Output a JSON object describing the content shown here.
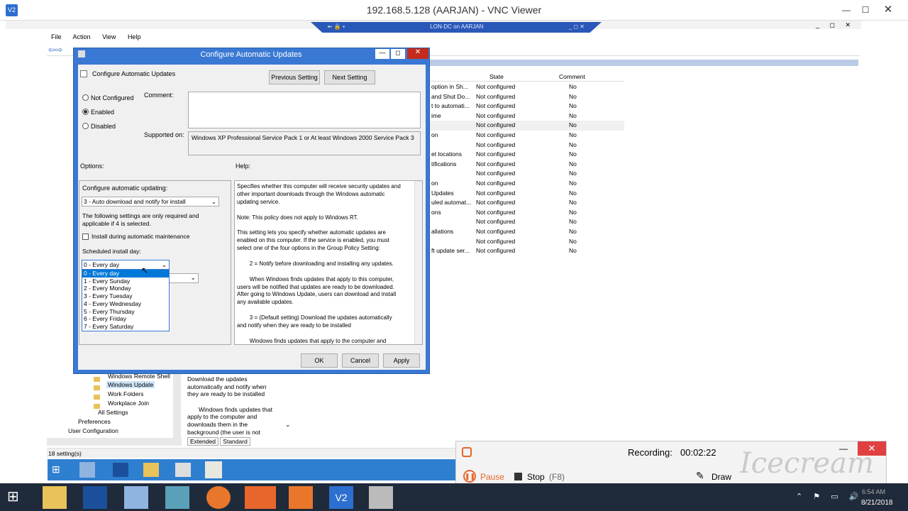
{
  "vnc": {
    "title": "192.168.5.128 (AARJAN) - VNC Viewer",
    "logo": "V2",
    "bar_text": "LON-DC on AARJAN"
  },
  "mmc": {
    "menu": [
      "File",
      "Action",
      "View",
      "Help"
    ],
    "columns": {
      "state": "State",
      "comment": "Comment"
    },
    "rows": [
      {
        "name": "option in Sh...",
        "state": "Not configured",
        "comment": "No"
      },
      {
        "name": "and Shut Do...",
        "state": "Not configured",
        "comment": "No"
      },
      {
        "name": "t to automati...",
        "state": "Not configured",
        "comment": "No"
      },
      {
        "name": "ime",
        "state": "Not configured",
        "comment": "No"
      },
      {
        "name": "",
        "state": "Not configured",
        "comment": "No"
      },
      {
        "name": "on",
        "state": "Not configured",
        "comment": "No"
      },
      {
        "name": "",
        "state": "Not configured",
        "comment": "No"
      },
      {
        "name": "et locations",
        "state": "Not configured",
        "comment": "No"
      },
      {
        "name": "tifications",
        "state": "Not configured",
        "comment": "No"
      },
      {
        "name": "",
        "state": "Not configured",
        "comment": "No"
      },
      {
        "name": "on",
        "state": "Not configured",
        "comment": "No"
      },
      {
        "name": "Updates",
        "state": "Not configured",
        "comment": "No"
      },
      {
        "name": "uled automat...",
        "state": "Not configured",
        "comment": "No"
      },
      {
        "name": "ons",
        "state": "Not configured",
        "comment": "No"
      },
      {
        "name": "",
        "state": "Not configured",
        "comment": "No"
      },
      {
        "name": "allations",
        "state": "Not configured",
        "comment": "No"
      },
      {
        "name": "",
        "state": "Not configured",
        "comment": "No"
      },
      {
        "name": "ft update ser...",
        "state": "Not configured",
        "comment": "No"
      }
    ],
    "tree": [
      "Windows Remote Shell",
      "Windows Update",
      "Work Folders",
      "Workplace Join",
      "All Settings",
      "Preferences",
      "User Configuration"
    ],
    "desc": [
      "Download the updates",
      "automatically and notify when",
      "they are ready to be installed",
      "",
      "Windows finds updates that",
      "apply to the computer and",
      "downloads them in the",
      "background (the user is not"
    ],
    "tabs": [
      "Extended",
      "Standard"
    ],
    "status": "18 setting(s)"
  },
  "dialog": {
    "title": "Configure Automatic Updates",
    "heading": "Configure Automatic Updates",
    "prev_btn": "Previous Setting",
    "next_btn": "Next Setting",
    "radios": [
      "Not Configured",
      "Enabled",
      "Disabled"
    ],
    "selected_radio": "Enabled",
    "comment_label": "Comment:",
    "supported_label": "Supported on:",
    "supported_value": "Windows XP Professional Service Pack 1 or At least Windows 2000 Service Pack 3",
    "options_label": "Options:",
    "help_label": "Help:",
    "configure_label": "Configure automatic updating:",
    "configure_value": "3 - Auto download and notify for install",
    "note_line1": "The following settings are only required and",
    "note_line2": "applicable if 4 is selected.",
    "maintenance_label": "Install during automatic maintenance",
    "install_day_label": "Scheduled install day:",
    "install_day_value": "0 - Every day",
    "day_options": [
      "0 - Every day",
      "1 - Every Sunday",
      "2 - Every Monday",
      "3 - Every Tuesday",
      "4 - Every Wednesday",
      "5 - Every Thursday",
      "6 - Every Friday",
      "7 - Every Saturday"
    ],
    "help_text": [
      "Specifies whether this computer will receive security updates and",
      "other important downloads through the Windows automatic",
      "updating service.",
      "",
      "Note: This policy does not apply to Windows RT.",
      "",
      "This setting lets you specify whether automatic updates are",
      "enabled on this computer. If the service is enabled, you must",
      "select one of the four options in the Group Policy Setting:",
      "",
      "        2 = Notify before downloading and installing any updates.",
      "",
      "        When Windows finds updates that apply to this computer,",
      "users will be notified that updates are ready to be downloaded.",
      "After going to Windows Update, users can download and install",
      "any available updates.",
      "",
      "        3 = (Default setting) Download the updates automatically",
      "and notify when they are ready to be installed",
      "",
      "        Windows finds updates that apply to the computer and"
    ],
    "ok": "OK",
    "cancel": "Cancel",
    "apply": "Apply"
  },
  "recorder": {
    "label": "Recording:",
    "time": "00:02:22",
    "pause": "Pause",
    "stop": "Stop",
    "stop_key": "(F8)",
    "draw": "Draw",
    "watermark": "Icecream"
  },
  "clock": {
    "time": "6:54 AM",
    "date": "8/21/2018"
  }
}
